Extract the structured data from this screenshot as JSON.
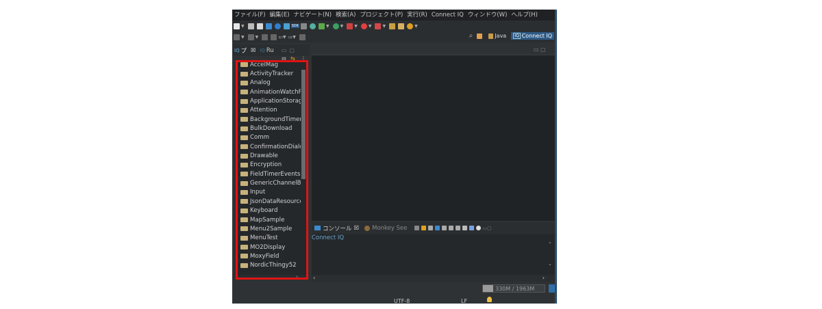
{
  "menu": [
    "ファイル(F)",
    "編集(E)",
    "ナビゲート(N)",
    "検索(A)",
    "プロジェクト(P)",
    "実行(R)",
    "Connect IQ",
    "ウィンドウ(W)",
    "ヘルプ(H)"
  ],
  "toolbar": {
    "sdk_label": "SDK"
  },
  "perspectives": {
    "java": "Java",
    "connect_iq": "Connect IQ",
    "connect_iq_icon_text": "IQ"
  },
  "left_tabs": {
    "tab1_icon_text": "IQ",
    "tab1_label": "プ",
    "tab1_close": "☒",
    "tab2_icon_text": "IQ",
    "tab2_label": "Ru"
  },
  "tree": [
    "AccelMag",
    "ActivityTracker",
    "Analog",
    "AnimationWatchFa",
    "ApplicationStorage",
    "Attention",
    "BackgroundTimer",
    "BulkDownload",
    "Comm",
    "ConfirmationDialog",
    "Drawable",
    "Encryption",
    "FieldTimerEvents",
    "GenericChannelBur",
    "Input",
    "JsonDataResources",
    "Keyboard",
    "MapSample",
    "Menu2Sample",
    "MenuTest",
    "MO2Display",
    "MoxyField",
    "NordicThingy52"
  ],
  "console": {
    "tab_label": "コンソール",
    "tab_close": "☒",
    "monkey_tab": "Monkey See",
    "content": "Connect IQ"
  },
  "status": {
    "memory": "330M / 1963M",
    "mem_used_fraction": 0.17,
    "frag1": "UTF-8",
    "frag2": "LF"
  },
  "colors": {
    "accent": "#2f5a86",
    "highlight_box": "#e01414",
    "console_text": "#6aa6ce"
  }
}
